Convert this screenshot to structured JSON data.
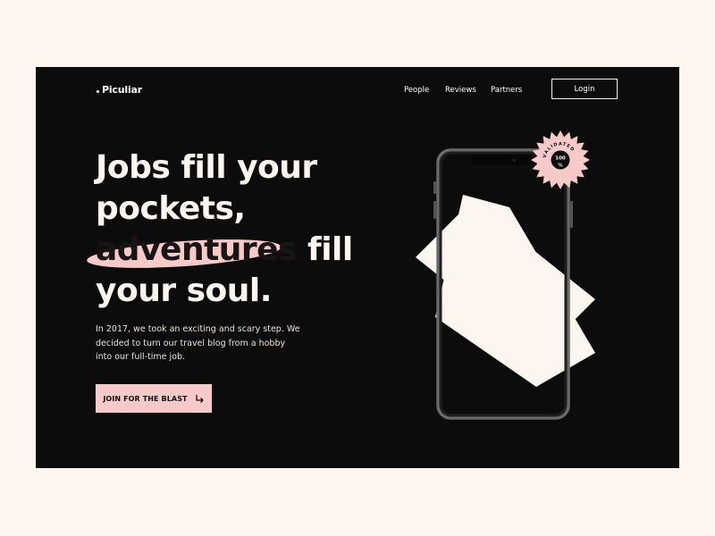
{
  "brand": {
    "name": "Piculiar"
  },
  "nav": {
    "items": [
      "People",
      "Reviews",
      "Partners"
    ],
    "login_label": "Login"
  },
  "hero": {
    "line1": "Jobs fill your",
    "line2": "pockets,",
    "line3_highlight": "adventures",
    "line3_rest": " fill",
    "line4": "your soul.",
    "description": "In 2017, we took an exciting and scary step. We decided to turn our travel blog from a hobby into our full-time job.",
    "cta_label": "JOIN FOR THE BLAST"
  },
  "badge": {
    "ring_text": "VALIDATED",
    "value": "100",
    "unit": "%"
  },
  "colors": {
    "frame": "#0d0c0c",
    "page": "#fdf6ee",
    "accent_pink": "#f7c9c9",
    "paper": "#fdf6ee"
  },
  "icons": {
    "cta_arrow": "return-arrow-icon"
  }
}
